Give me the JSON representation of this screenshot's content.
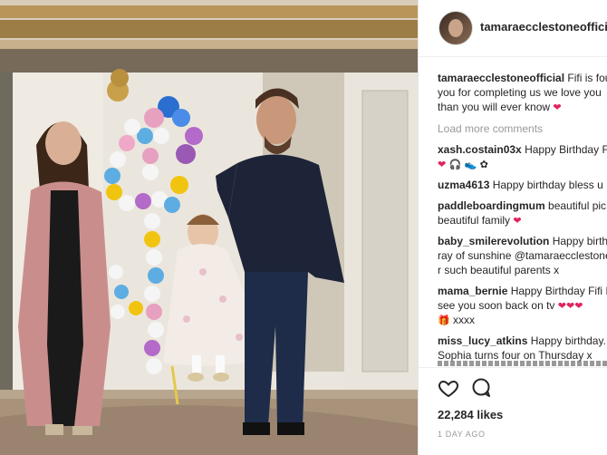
{
  "post": {
    "author": "tamaraecclestoneofficial",
    "caption_lines": [
      "Fifi is four",
      "you for completing us we love you",
      "than you will ever know"
    ],
    "caption_emoji": "heart-icon"
  },
  "load_more_label": "Load more comments",
  "comments": [
    {
      "user": "xash.costain03x",
      "lines": [
        "Happy Birthday F"
      ],
      "emoji_line": [
        "heart-icon",
        "headphones-icon",
        "shoe-icon",
        "flower-icon"
      ]
    },
    {
      "user": "uzma4613",
      "lines": [
        "Happy birthday bless u"
      ]
    },
    {
      "user": "paddleboardingmum",
      "lines": [
        "beautiful pic",
        "beautiful family"
      ],
      "trailing_emoji": "heart-icon"
    },
    {
      "user": "baby_smilerevolution",
      "lines": [
        "Happy birth",
        "ray of sunshine @tamaraecclestone",
        "r such beautiful parents x"
      ]
    },
    {
      "user": "mama_bernie",
      "lines": [
        "Happy Birthday Fifi I",
        "see you soon back on tv"
      ],
      "trailing_emoji": "heart-icon",
      "tail": "xxxx"
    },
    {
      "user": "miss_lucy_atkins",
      "lines": [
        "Happy birthday.",
        "Sophia turns four on Thursday x"
      ]
    }
  ],
  "likes": "22,284 likes",
  "time_ago": "1 DAY AGO"
}
